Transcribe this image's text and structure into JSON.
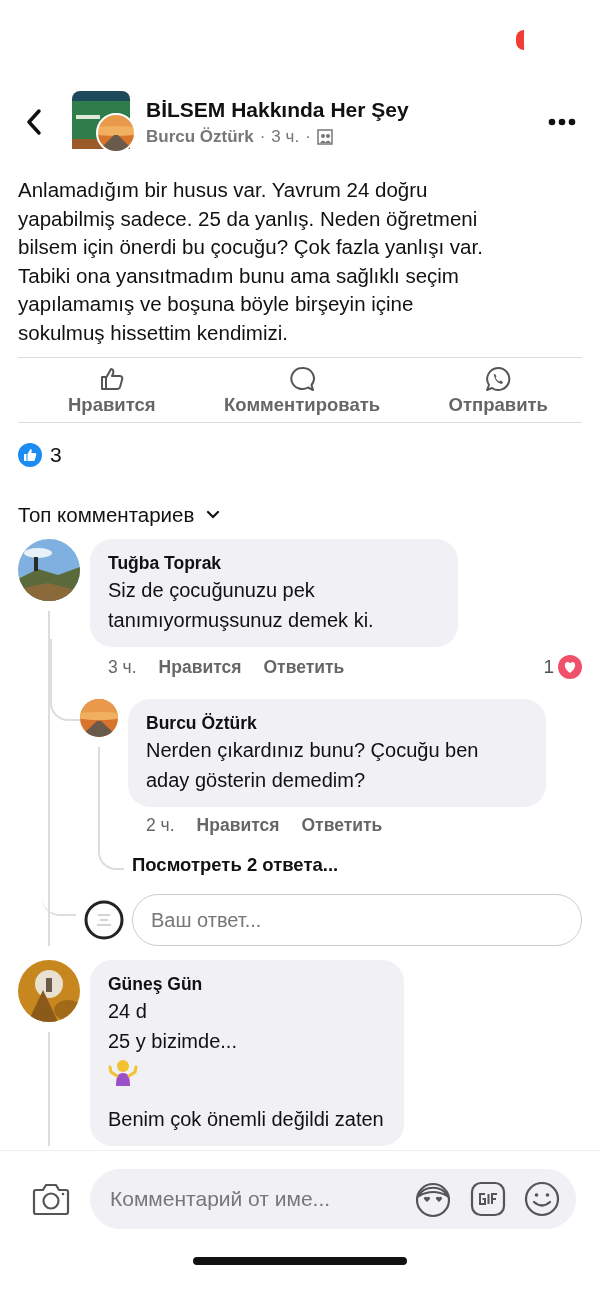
{
  "header": {
    "group_name": "BİLSEM Hakkında Her Şey",
    "author": "Burcu Öztürk",
    "separator": "·",
    "time": "3 ч.",
    "separator_2": "·"
  },
  "post": {
    "text": "Anlamadığım bir husus var. Yavrum 24 doğru yapabilmiş sadece. 25 da yanlış. Neden öğretmeni bilsem için önerdi bu çocuğu? Çok fazla yanlışı var. Tabiki ona yansıtmadım bunu ama sağlıklı seçim yapılamamış ve boşuna böyle birşeyin içine sokulmuş hissettim kendimizi."
  },
  "actions": [
    {
      "kind": "like",
      "label": "Нравится"
    },
    {
      "kind": "comment",
      "label": "Комментировать"
    },
    {
      "kind": "share",
      "label": "Отправить"
    }
  ],
  "reactions": {
    "count": "3"
  },
  "comments_sort": "Топ комментариев",
  "comments": [
    {
      "author": "Tuğba Toprak",
      "lines": [
        {
          "kind": "text",
          "text": "Siz de  çocuğunuzu pek tanımıyormuşsunuz demek ki."
        }
      ],
      "time": "3 ч.",
      "like": "Нравится",
      "reply": "Ответить",
      "reaction_count": "1",
      "replies": [
        {
          "author": "Burcu Öztürk",
          "lines": [
            {
              "kind": "text",
              "text": "Nerden çıkardınız bunu? Çocuğu ben aday gösterin demedim?"
            }
          ],
          "time": "2 ч.",
          "like": "Нравится",
          "reply": "Ответить"
        }
      ],
      "view_more": "Посмотреть 2 ответа...",
      "reply_placeholder": "Ваш ответ..."
    },
    {
      "author": "Güneş Gün",
      "lines": [
        {
          "kind": "text",
          "text": "24 d"
        },
        {
          "kind": "text",
          "text": "25 y bizimde..."
        },
        {
          "kind": "emoji"
        },
        {
          "kind": "gap"
        },
        {
          "kind": "text",
          "text": "Benim çok önemli değildi zaten"
        }
      ]
    }
  ],
  "composer": {
    "placeholder": "Комментарий от име..."
  }
}
